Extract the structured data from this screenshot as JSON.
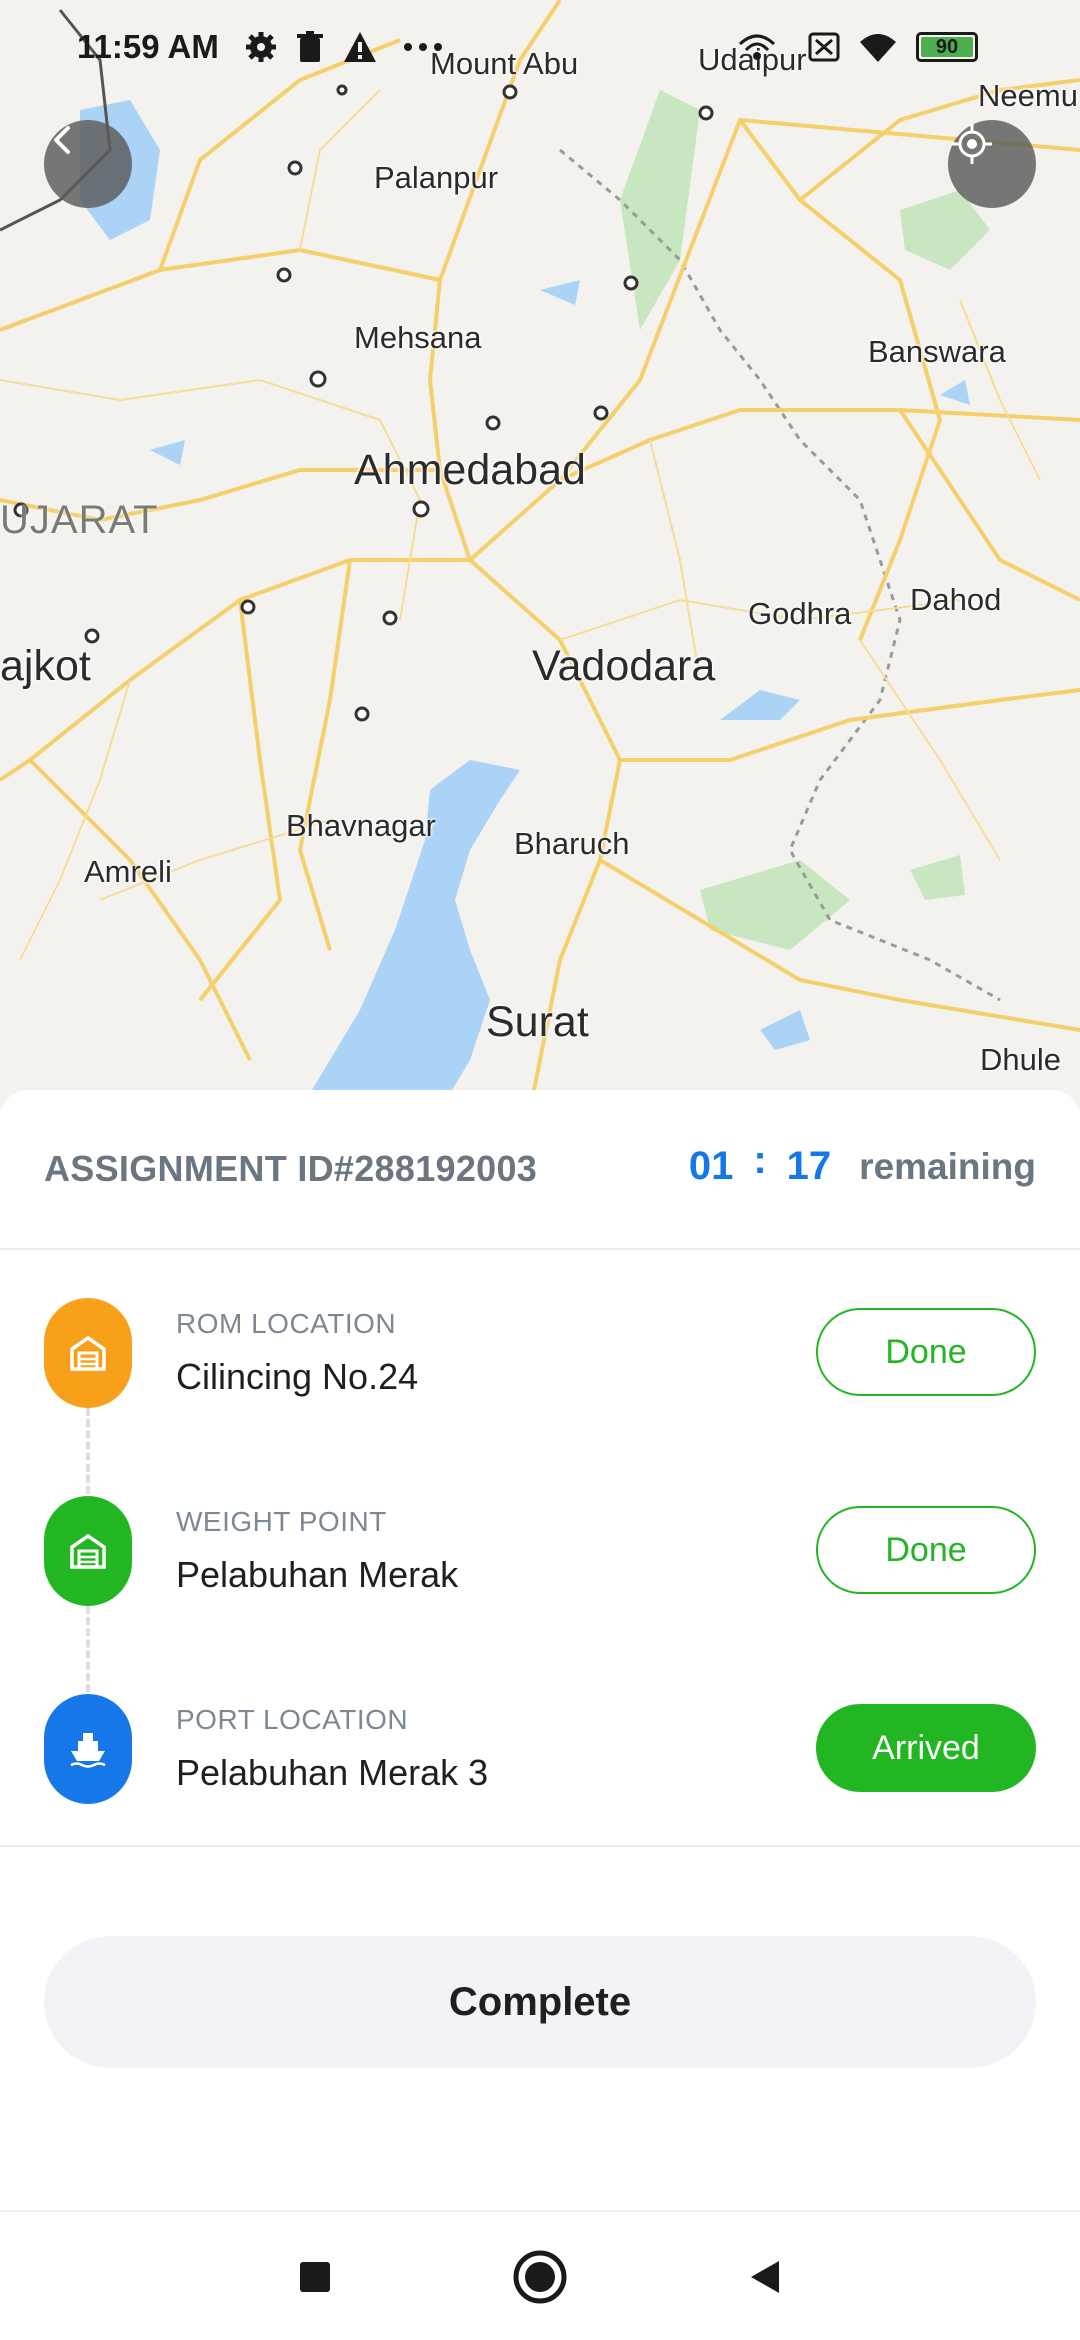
{
  "status_bar": {
    "time": "11:59 AM",
    "battery_level": "90",
    "icons": [
      "gear-icon",
      "trash-icon",
      "warning-icon",
      "more-dots-icon",
      "hotspot-icon",
      "sim-off-icon",
      "wifi-icon",
      "battery-icon"
    ]
  },
  "map": {
    "region_label": "UJARAT",
    "cities": [
      {
        "name": "Mount Abu",
        "size": "sm"
      },
      {
        "name": "Udaipur",
        "size": "sm"
      },
      {
        "name": "Neemu",
        "size": "sm"
      },
      {
        "name": "Palanpur",
        "size": "sm"
      },
      {
        "name": "Mehsana",
        "size": "sm"
      },
      {
        "name": "Banswara",
        "size": "sm"
      },
      {
        "name": "Ahmedabad",
        "size": "lg"
      },
      {
        "name": "Godhra",
        "size": "sm"
      },
      {
        "name": "Dahod",
        "size": "sm"
      },
      {
        "name": "ajkot",
        "size": "lg"
      },
      {
        "name": "Vadodara",
        "size": "lg"
      },
      {
        "name": "Bhavnagar",
        "size": "sm"
      },
      {
        "name": "Bharuch",
        "size": "sm"
      },
      {
        "name": "Amreli",
        "size": "sm"
      },
      {
        "name": "Surat",
        "size": "lg"
      },
      {
        "name": "Dhule",
        "size": "sm"
      }
    ],
    "colors": {
      "land": "#f3f2ee",
      "water": "#aad3f5",
      "road": "#f5cf6a",
      "park": "#c8e6c0"
    }
  },
  "assignment": {
    "id_text": "ASSIGNMENT ID#288192003",
    "timer_hours": "01",
    "timer_separator": ":",
    "timer_minutes": "17",
    "timer_suffix": "remaining"
  },
  "stops": [
    {
      "caption": "ROM LOCATION",
      "name": "Cilincing No.24",
      "status": "Done",
      "status_style": "outline",
      "color": "#f9a01b",
      "icon": "warehouse-icon"
    },
    {
      "caption": "WEIGHT POINT",
      "name": "Pelabuhan Merak",
      "status": "Done",
      "status_style": "outline",
      "color": "#23b623",
      "icon": "warehouse-icon"
    },
    {
      "caption": "PORT LOCATION",
      "name": "Pelabuhan Merak 3",
      "status": "Arrived",
      "status_style": "filled",
      "color": "#1677e8",
      "icon": "ship-icon"
    }
  ],
  "actions": {
    "complete_label": "Complete"
  },
  "colors": {
    "accent_blue": "#1677e8",
    "success_green": "#23b623",
    "orange": "#f9a01b",
    "muted_text": "#6b7683"
  }
}
